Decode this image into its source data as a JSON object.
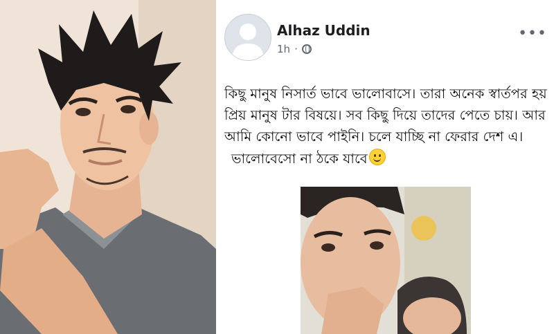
{
  "post": {
    "author": "Alhaz Uddin",
    "time": "1h",
    "separator": "·",
    "more_label": "•••",
    "text_paragraph_1": "কিছু মানুষ নিসার্ত ভাবে ভালোবাসে। তারা অনেক স্বার্তপর হয় প্রিয় মানুষ টার বিষয়ে। সব কিছু দিয়ে তাদের পেতে চায়। আর আমি কোনো ভাবে পাইনি। চলে যাচ্ছি না ফেরার দেশ এ।",
    "text_paragraph_2": "ভালোবেসো না ঠকে যাবে",
    "emoji": "slightly-smiling-face-emoji"
  },
  "icons": {
    "avatar": "default-avatar-icon",
    "privacy": "globe-icon",
    "more": "more-options-icon"
  },
  "colors": {
    "author": "#1c1e21",
    "meta": "#616770",
    "text": "#111111"
  }
}
